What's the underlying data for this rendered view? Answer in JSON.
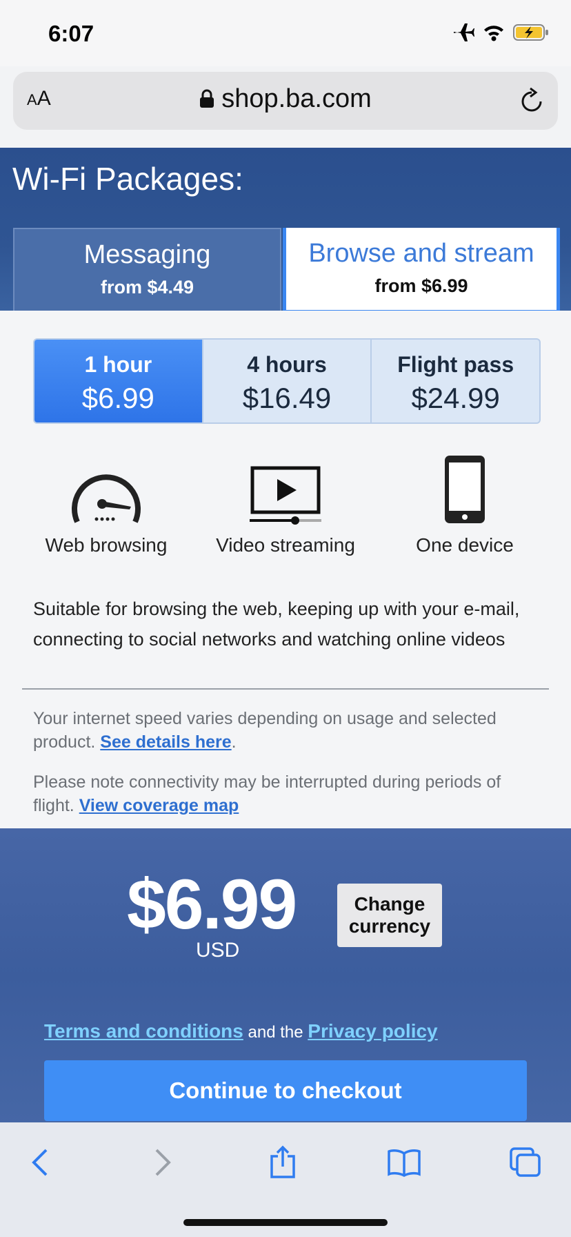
{
  "status_bar": {
    "time": "6:07"
  },
  "browser": {
    "aa_label_small": "A",
    "aa_label_big": "A",
    "url": "shop.ba.com"
  },
  "header": {
    "title": "Wi-Fi Packages:",
    "tabs": [
      {
        "name": "Messaging",
        "price": "from $4.49",
        "selected": false
      },
      {
        "name": "Browse and stream",
        "price": "from $6.99",
        "selected": true
      }
    ]
  },
  "durations": [
    {
      "name": "1 hour",
      "price": "$6.99",
      "selected": true
    },
    {
      "name": "4 hours",
      "price": "$16.49",
      "selected": false
    },
    {
      "name": "Flight pass",
      "price": "$24.99",
      "selected": false
    }
  ],
  "features": [
    {
      "label": "Web browsing",
      "icon": "speedometer-icon"
    },
    {
      "label": "Video streaming",
      "icon": "video-play-icon"
    },
    {
      "label": "One device",
      "icon": "phone-icon"
    }
  ],
  "description": "Suitable for browsing the web, keeping up with your e-mail, connecting to social networks and watching online videos",
  "notes": {
    "speed_text": "Your internet speed varies depending on usage and selected product. ",
    "speed_link": "See details here",
    "speed_end": ".",
    "coverage_text": "Please note connectivity may be interrupted during periods of flight. ",
    "coverage_link": "View coverage map"
  },
  "summary": {
    "price": "$6.99",
    "currency": "USD",
    "change_currency_line1": "Change",
    "change_currency_line2": "currency",
    "terms_link": "Terms and conditions",
    "legal_middle": " and the ",
    "privacy_link": "Privacy policy",
    "checkout_label": "Continue to checkout"
  },
  "colors": {
    "accent": "#3f8ef5",
    "header_blue": "#2f5593",
    "link": "#7fd1ff"
  }
}
